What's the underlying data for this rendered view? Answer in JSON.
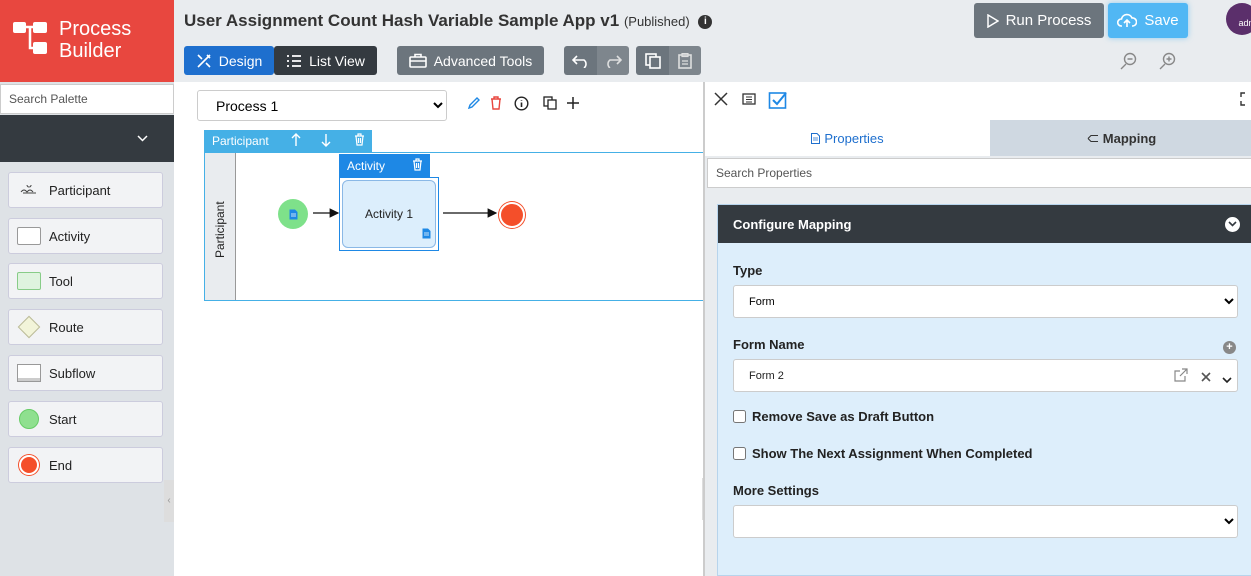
{
  "logo": {
    "line1": "Process",
    "line2": "Builder"
  },
  "header": {
    "app_title": "User Assignment Count Hash Variable Sample App v1",
    "status": "(Published)",
    "info_icon": "i",
    "design_label": "Design",
    "list_view_label": "List View",
    "advanced_tools_label": "Advanced Tools",
    "run_process_label": "Run Process",
    "save_label": "Save",
    "avatar_text": "admi"
  },
  "palette": {
    "search_placeholder": "Search Palette",
    "items": [
      {
        "label": "Participant",
        "icon": "swimlane-icon"
      },
      {
        "label": "Activity",
        "icon": "activity-icon"
      },
      {
        "label": "Tool",
        "icon": "tool-icon"
      },
      {
        "label": "Route",
        "icon": "route-icon"
      },
      {
        "label": "Subflow",
        "icon": "subflow-icon"
      },
      {
        "label": "Start",
        "icon": "start-icon"
      },
      {
        "label": "End",
        "icon": "end-icon"
      }
    ]
  },
  "canvas": {
    "process_select": {
      "value": "Process 1",
      "options": [
        "Process 1"
      ]
    },
    "participant_header": "Participant",
    "participant_label": "Participant",
    "activity_header": "Activity",
    "activity_name": "Activity 1"
  },
  "panel": {
    "tab_properties": "Properties",
    "tab_mapping": "Mapping",
    "search_placeholder": "Search Properties",
    "card_title": "Configure Mapping",
    "type_label": "Type",
    "type_value": "Form",
    "form_name_label": "Form Name",
    "form_name_value": "Form 2",
    "remove_draft_label": "Remove Save as Draft Button",
    "show_next_label": "Show The Next Assignment When Completed",
    "more_settings_label": "More Settings",
    "more_settings_value": ""
  },
  "colors": {
    "brand_red": "#e8473f",
    "design_blue": "#1e6fce",
    "save_blue": "#51b7f4",
    "pool_blue": "#45b0e6",
    "start_green": "#7ee18a",
    "end_red": "#f44f2a"
  }
}
